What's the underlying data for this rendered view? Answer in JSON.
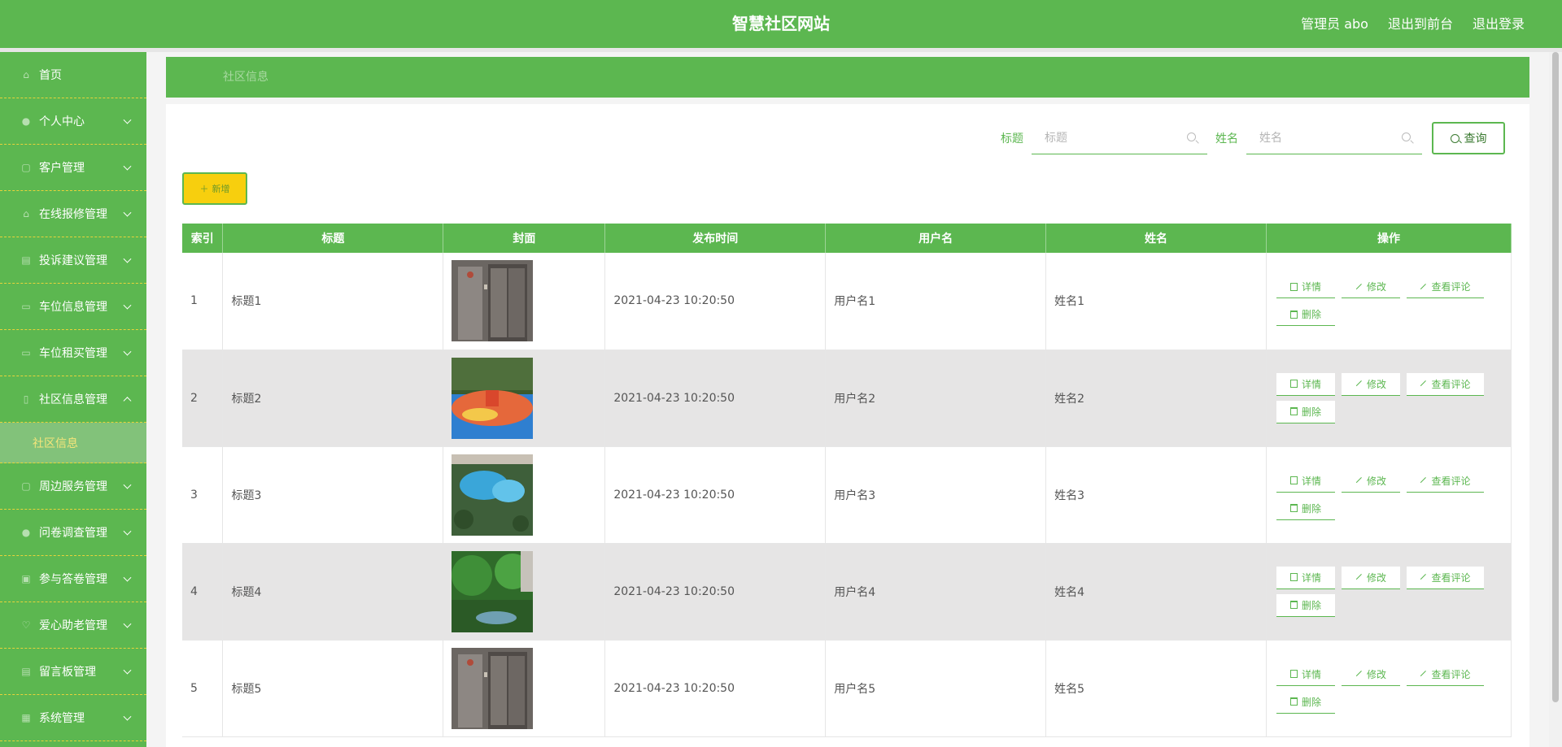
{
  "header": {
    "title": "智慧社区网站",
    "admin_label": "管理员 abo",
    "to_front": "退出到前台",
    "logout": "退出登录"
  },
  "sidebar": {
    "items": [
      {
        "label": "首页",
        "icon": "home-icon"
      },
      {
        "label": "个人中心",
        "icon": "user-icon"
      },
      {
        "label": "客户管理",
        "icon": "customer-icon"
      },
      {
        "label": "在线报修管理",
        "icon": "repair-icon"
      },
      {
        "label": "投诉建议管理",
        "icon": "complaint-icon"
      },
      {
        "label": "车位信息管理",
        "icon": "parking-icon"
      },
      {
        "label": "车位租买管理",
        "icon": "rent-icon"
      },
      {
        "label": "社区信息管理",
        "icon": "info-icon"
      },
      {
        "label": "周边服务管理",
        "icon": "service-icon"
      },
      {
        "label": "问卷调查管理",
        "icon": "survey-icon"
      },
      {
        "label": "参与答卷管理",
        "icon": "answer-icon"
      },
      {
        "label": "爱心助老管理",
        "icon": "heart-icon"
      },
      {
        "label": "留言板管理",
        "icon": "message-icon"
      },
      {
        "label": "系统管理",
        "icon": "system-icon"
      }
    ],
    "active_sub": "社区信息"
  },
  "breadcrumb": "社区信息",
  "search": {
    "title_label": "标题",
    "title_placeholder": "标题",
    "name_label": "姓名",
    "name_placeholder": "姓名",
    "query_button": "查询"
  },
  "add_button": "新增",
  "table": {
    "headers": [
      "索引",
      "标题",
      "封面",
      "发布时间",
      "用户名",
      "姓名",
      "操作"
    ],
    "rows": [
      {
        "index": "1",
        "title": "标题1",
        "time": "2021-04-23 10:20:50",
        "username": "用户名1",
        "name": "姓名1",
        "cover": "elevator"
      },
      {
        "index": "2",
        "title": "标题2",
        "time": "2021-04-23 10:20:50",
        "username": "用户名2",
        "name": "姓名2",
        "cover": "playground"
      },
      {
        "index": "3",
        "title": "标题3",
        "time": "2021-04-23 10:20:50",
        "username": "用户名3",
        "name": "姓名3",
        "cover": "pool"
      },
      {
        "index": "4",
        "title": "标题4",
        "time": "2021-04-23 10:20:50",
        "username": "用户名4",
        "name": "姓名4",
        "cover": "garden"
      },
      {
        "index": "5",
        "title": "标题5",
        "time": "2021-04-23 10:20:50",
        "username": "用户名5",
        "name": "姓名5",
        "cover": "elevator"
      }
    ],
    "ops": {
      "detail": "详情",
      "edit": "修改",
      "comments": "查看评论",
      "delete": "删除"
    }
  },
  "colors": {
    "primary": "#5cb750",
    "accent": "#f7cf0e",
    "active_text": "#f5e57a"
  }
}
